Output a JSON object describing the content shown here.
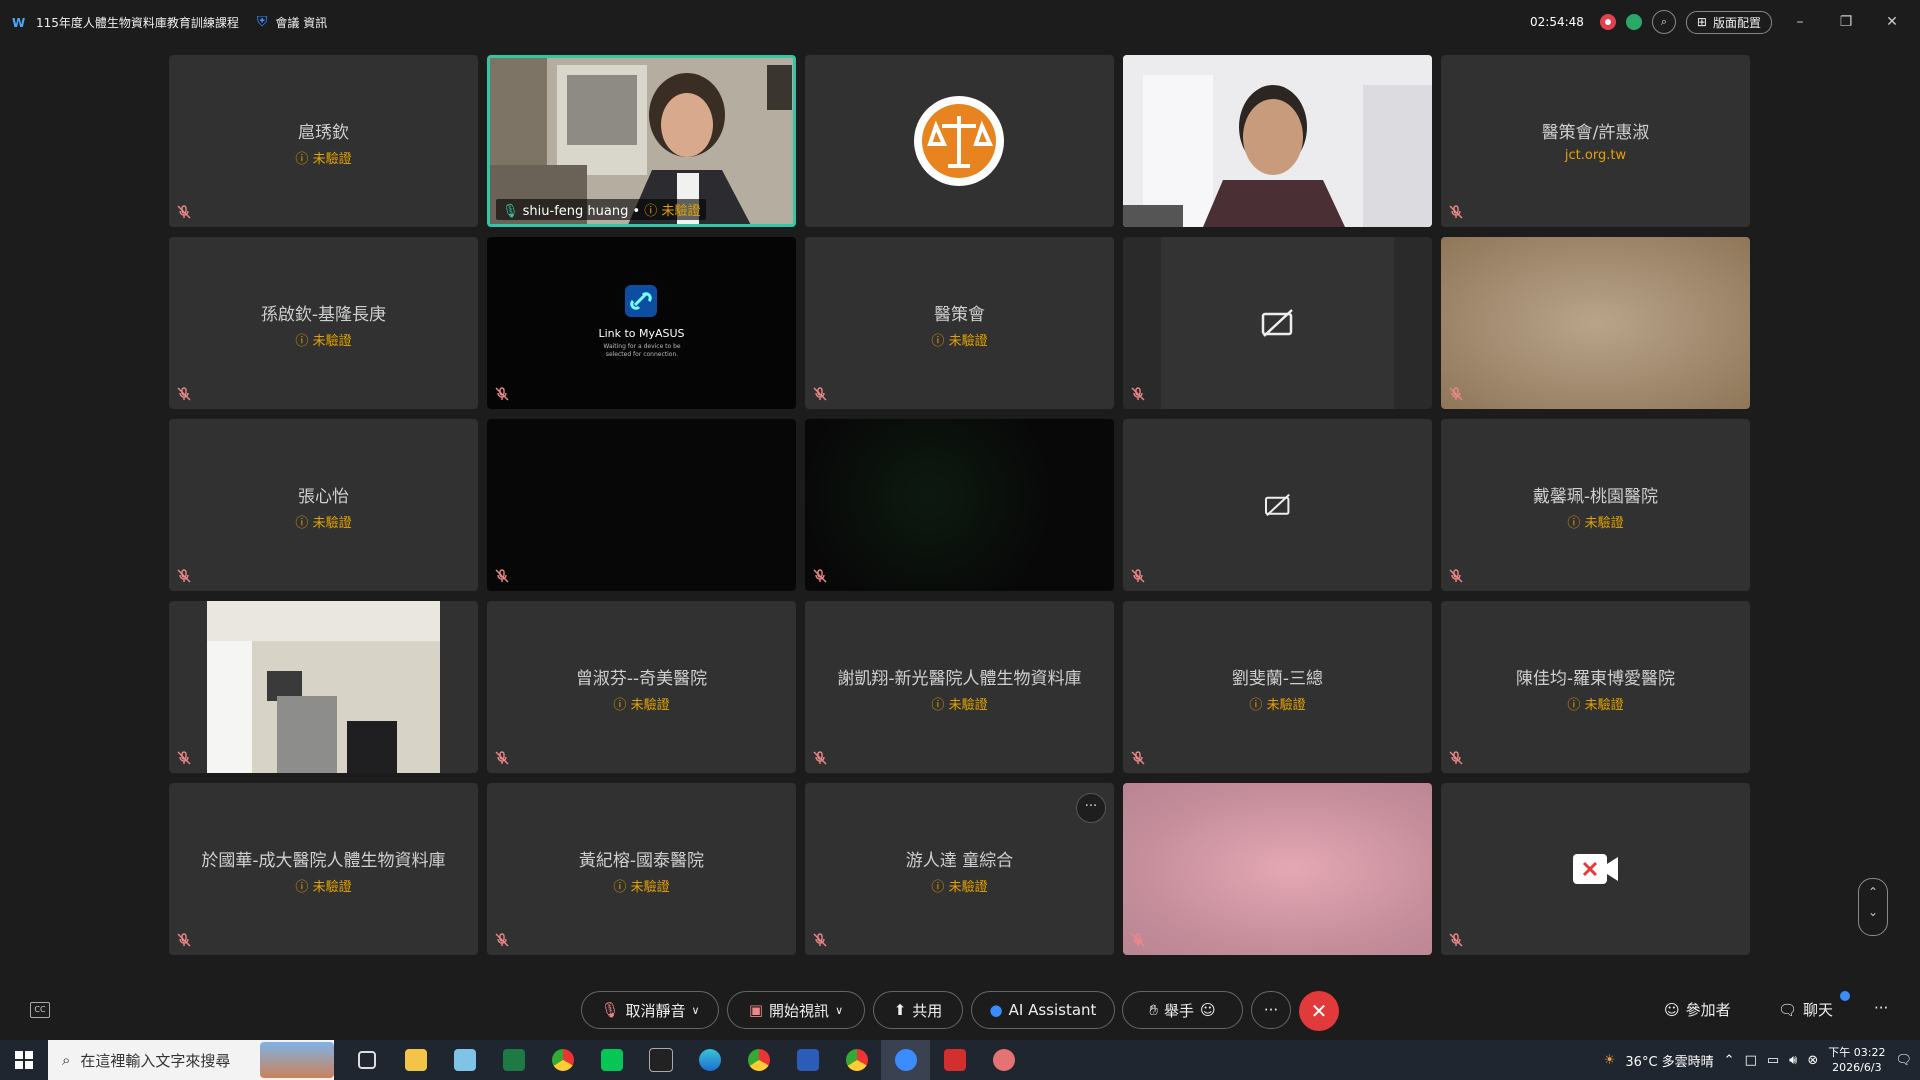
{
  "window": {
    "title": "115年度人體生物資料庫教育訓練課程",
    "meeting_info": "會議 資訊",
    "timer": "02:54:48",
    "layout_label": "版面配置"
  },
  "tiles": [
    {
      "name": "扈琇欽",
      "status": "未驗證"
    },
    {
      "name": "shiu-feng huang",
      "status": "未驗證"
    },
    {
      "name": "",
      "status": ""
    },
    {
      "name": "",
      "status": ""
    },
    {
      "name": "醫策會/許惠淑",
      "sub": "jct.org.tw"
    },
    {
      "name": "孫啟欽-基隆長庚",
      "status": "未驗證"
    },
    {
      "name": "Link to MyASUS",
      "sub": "Waiting for a device to be selected for connection."
    },
    {
      "name": "醫策會",
      "status": "未驗證"
    },
    {
      "name": "",
      "status": ""
    },
    {
      "name": "",
      "status": ""
    },
    {
      "name": "張心怡",
      "status": "未驗證"
    },
    {
      "name": "",
      "status": ""
    },
    {
      "name": "",
      "status": ""
    },
    {
      "name": "",
      "status": ""
    },
    {
      "name": "戴馨珮-桃園醫院",
      "status": "未驗證"
    },
    {
      "name": "",
      "status": ""
    },
    {
      "name": "曾淑芬--奇美醫院",
      "status": "未驗證"
    },
    {
      "name": "謝凱翔-新光醫院人體生物資料庫",
      "status": "未驗證"
    },
    {
      "name": "劉斐蘭-三總",
      "status": "未驗證"
    },
    {
      "name": "陳佳均-羅東博愛醫院",
      "status": "未驗證"
    },
    {
      "name": "於國華-成大醫院人體生物資料庫",
      "status": "未驗證"
    },
    {
      "name": "黃紀榕-國泰醫院",
      "status": "未驗證"
    },
    {
      "name": "游人達 童綜合",
      "status": "未驗證"
    },
    {
      "name": "",
      "status": ""
    },
    {
      "name": "",
      "status": ""
    }
  ],
  "toolbar": {
    "unmute": "取消靜音",
    "start_video": "開始視訊",
    "share": "共用",
    "ai_assistant": "AI Assistant",
    "raise_hand": "舉手",
    "participants": "參加者",
    "chat": "聊天",
    "more": "···"
  },
  "taskbar": {
    "search_placeholder": "在這裡輸入文字來搜尋",
    "weather": "36°C 多雲時晴",
    "time": "下午 03:22",
    "date": "2026/6/3"
  }
}
